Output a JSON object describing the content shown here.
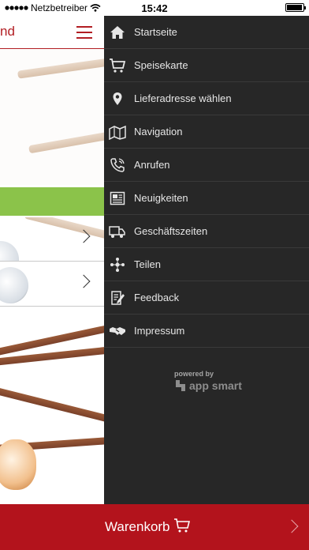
{
  "status_bar": {
    "carrier": "Netzbetreiber",
    "time": "15:42"
  },
  "app": {
    "title_fragment": "nd",
    "brand_color": "#b21e23",
    "accent_green": "#8bc34a"
  },
  "drawer": {
    "items": [
      {
        "label": "Startseite",
        "icon": "home-icon"
      },
      {
        "label": "Speisekarte",
        "icon": "cart-icon"
      },
      {
        "label": "Lieferadresse wählen",
        "icon": "location-pin-icon"
      },
      {
        "label": "Navigation",
        "icon": "map-icon"
      },
      {
        "label": "Anrufen",
        "icon": "phone-icon"
      },
      {
        "label": "Neuigkeiten",
        "icon": "newspaper-icon"
      },
      {
        "label": "Geschäftszeiten",
        "icon": "delivery-clock-icon"
      },
      {
        "label": "Teilen",
        "icon": "share-icon"
      },
      {
        "label": "Feedback",
        "icon": "feedback-icon"
      },
      {
        "label": "Impressum",
        "icon": "handshake-icon"
      }
    ],
    "powered_by": "powered by",
    "brand": "app smart"
  },
  "cart": {
    "label": "Warenkorb",
    "color": "#b3131c"
  }
}
